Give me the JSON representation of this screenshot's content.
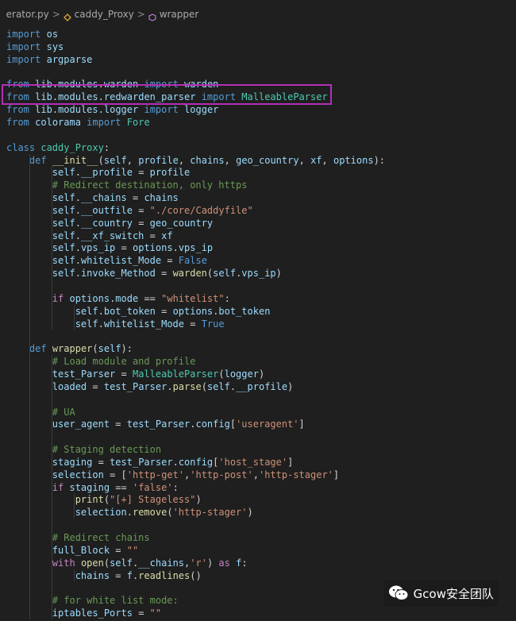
{
  "breadcrumb": {
    "file": "erator.py",
    "sep1": ">",
    "class_name": "caddy_Proxy",
    "sep2": ">",
    "method": "wrapper"
  },
  "code_lines": [
    "import os",
    "import sys",
    "import argparse",
    "",
    "from lib.modules.warden import warden",
    "from lib.modules.redwarden_parser import MalleableParser",
    "from lib.modules.logger import logger",
    "from colorama import Fore",
    "",
    "class caddy_Proxy:",
    "    def __init__(self, profile, chains, geo_country, xf, options):",
    "        self.__profile = profile",
    "        # Redirect destination, only https",
    "        self.__chains = chains",
    "        self.__outfile = \"./core/Caddyfile\"",
    "        self.__country = geo_country",
    "        self.__xf_switch = xf",
    "        self.vps_ip = options.vps_ip",
    "        self.whitelist_Mode = False",
    "        self.invoke_Method = warden(self.vps_ip)",
    "",
    "        if options.mode == \"whitelist\":",
    "            self.bot_token = options.bot_token",
    "            self.whitelist_Mode = True",
    "",
    "    def wrapper(self):",
    "        # Load module and profile",
    "        test_Parser = MalleableParser(logger)",
    "        loaded = test_Parser.parse(self.__profile)",
    "",
    "        # UA",
    "        user_agent = test_Parser.config['useragent']",
    "",
    "        # Staging detection",
    "        staging = test_Parser.config['host_stage']",
    "        selection = ['http-get','http-post','http-stager']",
    "        if staging == 'false':",
    "            print(\"[+] Stageless\")",
    "            selection.remove('http-stager')",
    "",
    "        # Redirect chains",
    "        full_Block = \"\"",
    "        with open(self.__chains,'r') as f:",
    "            chains = f.readlines()",
    "",
    "        # for white list mode:",
    "        iptables_Ports = \"\""
  ],
  "watermark": {
    "text": "Gcow安全团队",
    "icon": "wechat-icon"
  },
  "colors": {
    "background": "#1f1f1f",
    "highlight_border": "#b32fb5",
    "keyword": "#569cd6",
    "control_keyword": "#c586c0",
    "function": "#dcdcaa",
    "class": "#4ec9b0",
    "variable": "#9cdcfe",
    "string": "#ce9178",
    "comment": "#6a9955"
  }
}
